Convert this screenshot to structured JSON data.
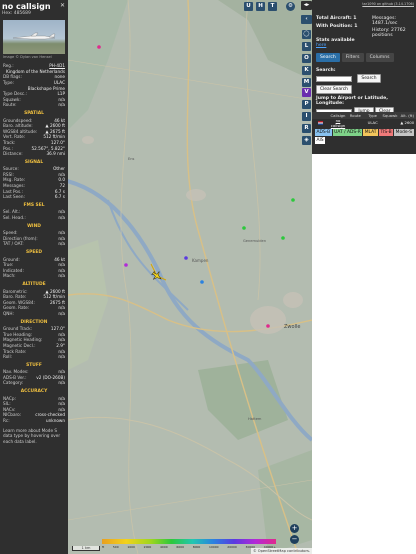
{
  "selected": {
    "callsign": "no callsign",
    "hex_label": "Hex:",
    "hex": "485689",
    "photo_credit": "Image © Dylan van Hensel",
    "info": [
      {
        "k": "Reg.:",
        "v": "PH-4D1",
        "link": true
      },
      {
        "k": "",
        "v": "Kingdom of the Netherlands"
      },
      {
        "k": "DB flags:",
        "v": "none"
      },
      {
        "k": "Type:",
        "v": "ULAC"
      },
      {
        "k": "",
        "v": "Blackshape Prime"
      },
      {
        "k": "Type Desc.:",
        "v": "L1P"
      },
      {
        "k": "Squawk:",
        "v": "n/a"
      },
      {
        "k": "Route:",
        "v": "n/a"
      }
    ],
    "sections": [
      {
        "title": "SPATIAL",
        "rows": [
          {
            "k": "Groundspeed:",
            "v": "46 kt"
          },
          {
            "k": "Baro. altitude:",
            "v": "▲ 2600 ft"
          },
          {
            "k": "WGS84 altitude:",
            "v": "▲ 2675 ft"
          },
          {
            "k": "Vert. Rate:",
            "v": "512 ft/min"
          },
          {
            "k": "Track:",
            "v": "127.0°"
          },
          {
            "k": "Pos.:",
            "v": "52.567°, 5.822°"
          },
          {
            "k": "Distance:",
            "v": "36.9 nmi"
          }
        ]
      },
      {
        "title": "SIGNAL",
        "rows": [
          {
            "k": "Source:",
            "v": "Other"
          },
          {
            "k": "RSSI:",
            "v": "n/a"
          },
          {
            "k": "Msg. Rate:",
            "v": "0.0"
          },
          {
            "k": "Messages:",
            "v": "72"
          },
          {
            "k": "Last Pos.:",
            "v": "6.7 s"
          },
          {
            "k": "Last Seen:",
            "v": "6.7 s"
          }
        ]
      },
      {
        "title": "FMS SEL",
        "rows": [
          {
            "k": "Sel. Alt.:",
            "v": "n/a"
          },
          {
            "k": "Sel. Head.:",
            "v": "n/a"
          }
        ]
      },
      {
        "title": "WIND",
        "rows": [
          {
            "k": "Speed:",
            "v": "n/a"
          },
          {
            "k": "Direction (from):",
            "v": "n/a"
          },
          {
            "k": "TAT / OAT:",
            "v": "n/a"
          }
        ]
      },
      {
        "title": "SPEED",
        "rows": [
          {
            "k": "Ground:",
            "v": "46 kt"
          },
          {
            "k": "True:",
            "v": "n/a"
          },
          {
            "k": "Indicated:",
            "v": "n/a"
          },
          {
            "k": "Mach:",
            "v": "n/a"
          }
        ]
      },
      {
        "title": "ALTITUDE",
        "rows": [
          {
            "k": "Barometric:",
            "v": "▲ 2600 ft"
          },
          {
            "k": "Baro. Rate:",
            "v": "512 ft/min"
          },
          {
            "k": "Geom. WGS84:",
            "v": "2675 ft"
          },
          {
            "k": "Geom. Rate:",
            "v": "n/a"
          },
          {
            "k": "QNH:",
            "v": "n/a"
          }
        ]
      },
      {
        "title": "DIRECTION",
        "rows": [
          {
            "k": "Ground Track:",
            "v": "127.0°"
          },
          {
            "k": "True Heading:",
            "v": "n/a"
          },
          {
            "k": "Magnetic Heading:",
            "v": "n/a"
          },
          {
            "k": "Magnetic Decl.:",
            "v": "2.9°"
          },
          {
            "k": "Track Rate:",
            "v": "n/a"
          },
          {
            "k": "Roll:",
            "v": "n/a"
          }
        ]
      },
      {
        "title": "STUFF",
        "rows": [
          {
            "k": "Nav. Modes:",
            "v": "n/a"
          },
          {
            "k": "ADS-B Ver.:",
            "v": "v2 (DO-260B)"
          },
          {
            "k": "Category:",
            "v": "n/a"
          }
        ]
      },
      {
        "title": "ACCURACY",
        "rows": [
          {
            "k": "NACp:",
            "v": "n/a"
          },
          {
            "k": "SIL:",
            "v": "n/a"
          },
          {
            "k": "NACv:",
            "v": "n/a"
          },
          {
            "k": "NICbaro:",
            "v": "cross-checked"
          },
          {
            "k": "Rc:",
            "v": "unknown"
          }
        ]
      }
    ],
    "footer_note": "Learn more about Mode S data type by hovering over each data label."
  },
  "map": {
    "buttons": [
      "U",
      "H",
      "T"
    ],
    "side_buttons": [
      "L",
      "O",
      "K",
      "M",
      "P",
      "I",
      "R"
    ],
    "zoom_in": "+",
    "zoom_out": "−",
    "scale_label": "1 km",
    "attribution": "© OpenStreetMap contributors.",
    "alt_legend": [
      "ft",
      "500",
      "1000",
      "2000",
      "4000",
      "6000",
      "8000",
      "10000",
      "20000",
      "30000",
      "40000+"
    ],
    "places": [
      "Kampen",
      "Zwolle",
      "Hattem",
      "Ens",
      "Kraggenburg",
      "Emmeloord",
      "Dronten",
      "Wezep",
      "Genemuiden"
    ]
  },
  "sidebar": {
    "credit": "tar1090 on github (3.14.1706)",
    "stats": [
      {
        "k": "Total Aircraft:",
        "v": "1"
      },
      {
        "k": "With Position:",
        "v": "1"
      }
    ],
    "messages": "Messages: 1487.1/sec",
    "history": "History: 27762 positions",
    "stats_label": "Stats available",
    "stats_link": "here",
    "tabs": [
      "Search",
      "Filters",
      "Columns"
    ],
    "search_label": "Search:",
    "search_btn": "Search",
    "clear_btn": "Clear Search",
    "jump_label": "Jump to Airport or Latitude, Longitude:",
    "jump_btn": "Jump",
    "clear_jump_btn": "Clear",
    "table_headers": [
      "",
      "Callsign",
      "Route",
      "Type",
      "Squawk",
      "Alt. (ft)"
    ],
    "rows": [
      {
        "callsign": "no callsign",
        "route": "",
        "type": "ULAC",
        "squawk": "",
        "alt": "2600"
      }
    ],
    "badges": [
      {
        "label": "ADS-B",
        "color": "#88c2f0"
      },
      {
        "label": "UAT / ADS-R",
        "color": "#7fd389"
      },
      {
        "label": "MLAT",
        "color": "#f2c55c"
      },
      {
        "label": "TIS-B",
        "color": "#f07a7a"
      },
      {
        "label": "Mode-S",
        "color": "#c4c4c4"
      },
      {
        "label": "AIS",
        "color": "#ffffff"
      }
    ]
  }
}
